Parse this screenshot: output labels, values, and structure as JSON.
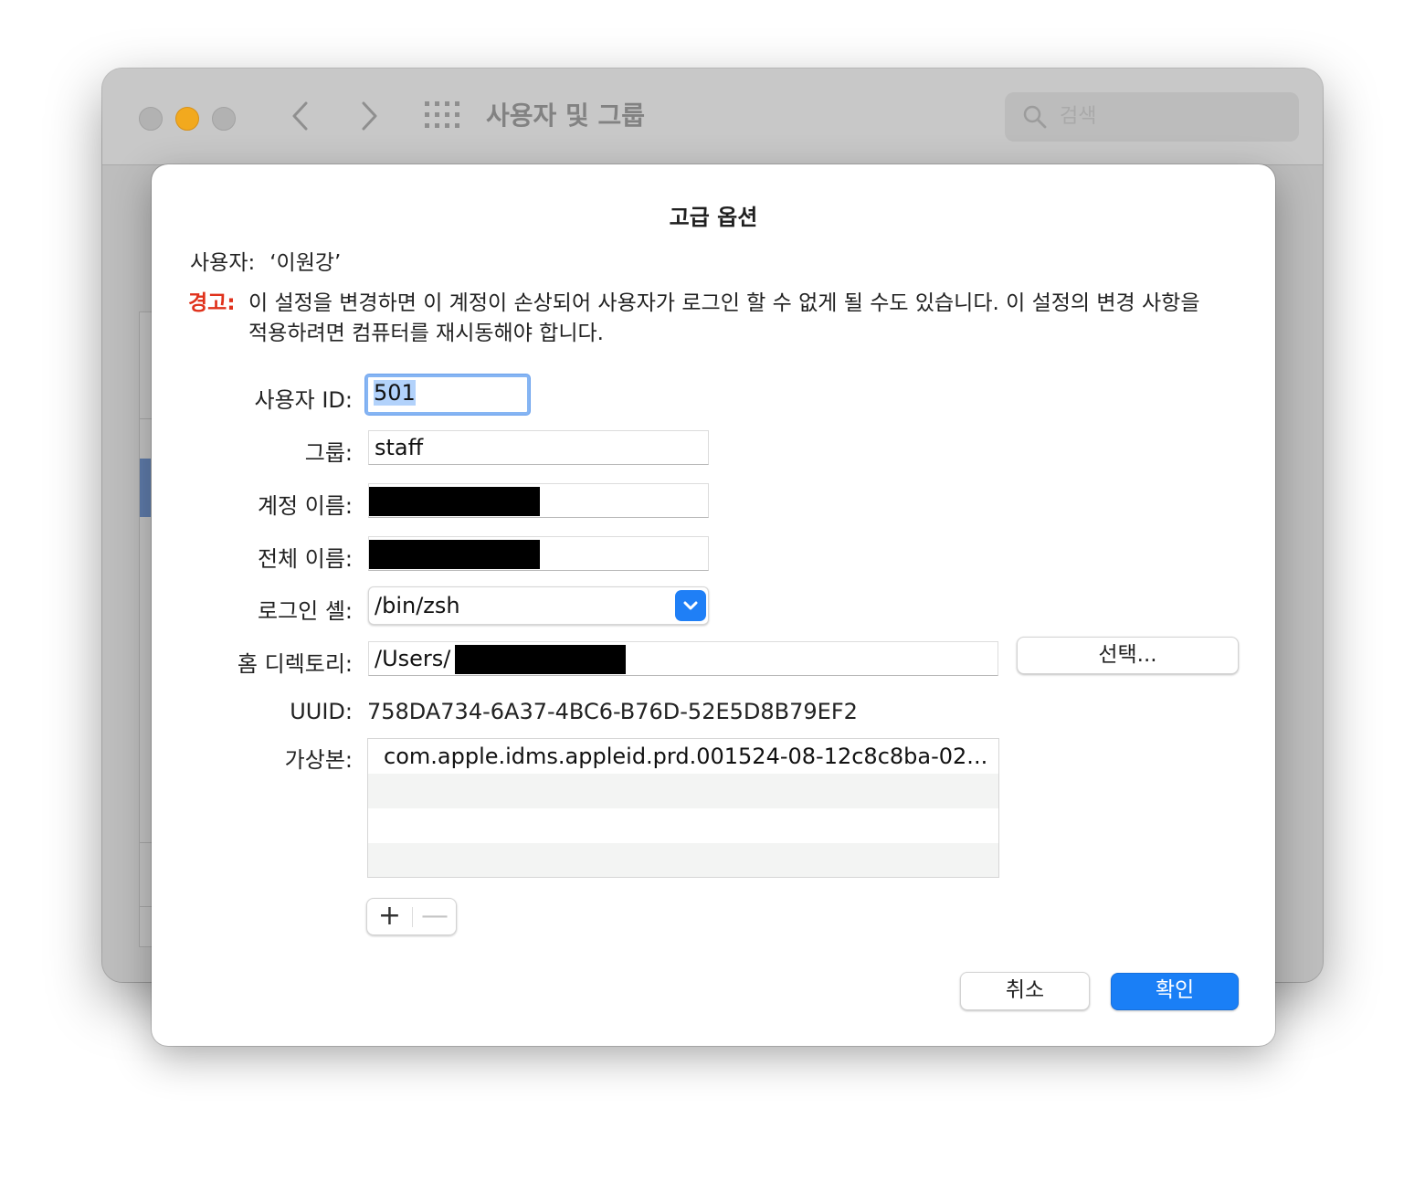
{
  "window": {
    "title": "사용자 및 그룹",
    "search_placeholder": "검색",
    "back_glyph": "‹",
    "forward_glyph": "›"
  },
  "dialog": {
    "title": "고급 옵션",
    "user_label": "사용자:",
    "user_value": "‘이원강’",
    "warning_label": "경고:",
    "warning_text": "이 설정을 변경하면 이 계정이 손상되어 사용자가 로그인 할 수 없게 될 수도 있습니다. 이 설정의 변경 사항을 적용하려면 컴퓨터를 재시동해야 합니다.",
    "fields": {
      "user_id_label": "사용자 ID:",
      "user_id_value": "501",
      "group_label": "그룹:",
      "group_value": "staff",
      "account_name_label": "계정 이름:",
      "full_name_label": "전체 이름:",
      "login_shell_label": "로그인 셸:",
      "login_shell_value": "/bin/zsh",
      "home_dir_label": "홈 디렉토리:",
      "home_dir_value": "/Users/",
      "uuid_label": "UUID:",
      "uuid_value": "758DA734-6A37-4BC6-B76D-52E5D8B79EF2",
      "aliases_label": "가상본:"
    },
    "aliases": [
      "com.apple.idms.appleid.prd.001524-08-12c8c8ba-02..."
    ],
    "choose_button": "선택...",
    "add_glyph": "+",
    "remove_glyph": "—",
    "cancel_button": "취소",
    "ok_button": "확인",
    "colors": {
      "accent": "#1a7ff6",
      "warning": "#e0321c"
    }
  }
}
